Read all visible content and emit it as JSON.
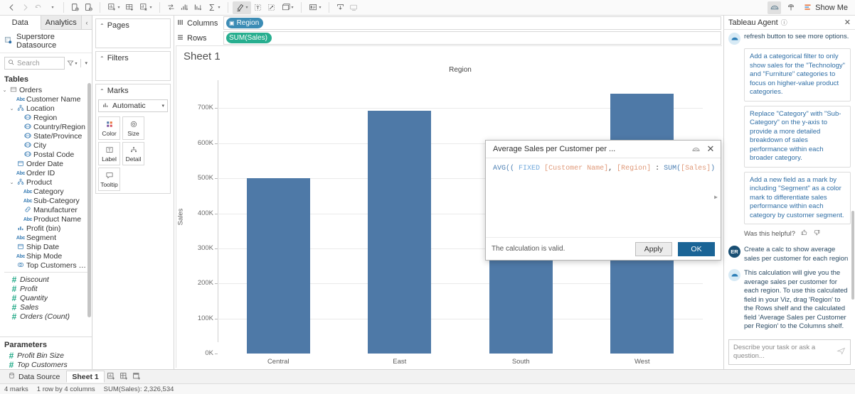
{
  "toolbar": {
    "back_icon": "back-arrow-icon",
    "forward_icon": "forward-arrow-icon",
    "undo_icon": "undo-icon",
    "save_icon": "save-icon",
    "pause_icon": "pause-auto-update-icon",
    "new_sheet_icon": "new-worksheet-icon",
    "new_dashboard_icon": "new-dashboard-icon",
    "clear_icon": "clear-sheet-icon",
    "swap_icon": "swap-rows-columns-icon",
    "sort_asc_icon": "sort-ascending-icon",
    "sort_desc_icon": "sort-descending-icon",
    "totals_icon": "totals-icon",
    "highlight_icon": "highlighter-icon",
    "labels_icon": "show-mark-labels-icon",
    "fit_icon": "fix-axes-icon",
    "fitsize_icon": "fit-selector-icon",
    "presentation_icon": "presentation-mode-icon",
    "card_icon": "show-hide-cards-icon",
    "download_icon": "download-icon",
    "device_icon": "device-preview-icon",
    "ai_icon": "einstein-copilot-icon",
    "showme_icon": "show-me-icon",
    "showme_label": "Show Me"
  },
  "data_pane": {
    "tab_data": "Data",
    "tab_analytics": "Analytics",
    "collapse_icon": "collapse-pane-icon",
    "datasource_name": "Superstore Datasource",
    "datasource_icon": "datasource-icon",
    "search_placeholder": "Search",
    "search_icon": "search-icon",
    "filter_icon": "filter-sort-icon",
    "menu_icon": "chevron-down-icon",
    "tables_header": "Tables",
    "fields": [
      {
        "label": "Orders",
        "icon": "table-icon",
        "indent": 0,
        "twisty": "open"
      },
      {
        "label": "Customer Name",
        "icon": "abc",
        "indent": 1,
        "twisty": ""
      },
      {
        "label": "Location",
        "icon": "hierarchy",
        "indent": 1,
        "twisty": "open"
      },
      {
        "label": "Region",
        "icon": "geo",
        "indent": 2,
        "twisty": ""
      },
      {
        "label": "Country/Region",
        "icon": "geo",
        "indent": 2,
        "twisty": ""
      },
      {
        "label": "State/Province",
        "icon": "geo",
        "indent": 2,
        "twisty": ""
      },
      {
        "label": "City",
        "icon": "geo",
        "indent": 2,
        "twisty": ""
      },
      {
        "label": "Postal Code",
        "icon": "geo",
        "indent": 2,
        "twisty": ""
      },
      {
        "label": "Order Date",
        "icon": "date",
        "indent": 1,
        "twisty": ""
      },
      {
        "label": "Order ID",
        "icon": "abc",
        "indent": 1,
        "twisty": ""
      },
      {
        "label": "Product",
        "icon": "hierarchy",
        "indent": 1,
        "twisty": "open"
      },
      {
        "label": "Category",
        "icon": "abc",
        "indent": 2,
        "twisty": ""
      },
      {
        "label": "Sub-Category",
        "icon": "abc",
        "indent": 2,
        "twisty": ""
      },
      {
        "label": "Manufacturer",
        "icon": "link",
        "indent": 2,
        "twisty": ""
      },
      {
        "label": "Product Name",
        "icon": "abc",
        "indent": 2,
        "twisty": ""
      },
      {
        "label": "Profit (bin)",
        "icon": "bin",
        "indent": 1,
        "twisty": ""
      },
      {
        "label": "Segment",
        "icon": "abc",
        "indent": 1,
        "twisty": ""
      },
      {
        "label": "Ship Date",
        "icon": "date",
        "indent": 1,
        "twisty": ""
      },
      {
        "label": "Ship Mode",
        "icon": "abc",
        "indent": 1,
        "twisty": ""
      },
      {
        "label": "Top Customers by P...",
        "icon": "set",
        "indent": 1,
        "twisty": ""
      }
    ],
    "measures": [
      {
        "label": "Discount",
        "icon": "num"
      },
      {
        "label": "Profit",
        "icon": "num"
      },
      {
        "label": "Quantity",
        "icon": "num"
      },
      {
        "label": "Sales",
        "icon": "num"
      },
      {
        "label": "Orders (Count)",
        "icon": "num"
      }
    ],
    "parameters_header": "Parameters",
    "parameters": [
      {
        "label": "Profit Bin Size",
        "icon": "num"
      },
      {
        "label": "Top Customers",
        "icon": "num"
      }
    ]
  },
  "shelves": {
    "pages_label": "Pages",
    "filters_label": "Filters",
    "marks_label": "Marks",
    "marks_type": "Automatic",
    "marks_type_icon": "bar-mark-icon",
    "marks_buttons": [
      {
        "label": "Color",
        "icon": "color-icon"
      },
      {
        "label": "Size",
        "icon": "size-icon"
      },
      {
        "label": "Label",
        "icon": "label-icon"
      },
      {
        "label": "Detail",
        "icon": "detail-icon"
      },
      {
        "label": "Tooltip",
        "icon": "tooltip-icon"
      }
    ],
    "columns_label": "Columns",
    "columns_icon": "columns-icon",
    "rows_label": "Rows",
    "rows_icon": "rows-icon",
    "columns_pill": "Region",
    "columns_pill_icon": "dimension-icon",
    "rows_pill": "SUM(Sales)",
    "dimension_color": "#3c8cb5",
    "measure_color": "#27ae8f"
  },
  "viz": {
    "sheet_title": "Sheet 1",
    "bar_color": "#4e79a7"
  },
  "chart_data": {
    "type": "bar",
    "title": "Sheet 1",
    "column_header": "Region",
    "xlabel": "Region",
    "ylabel": "Sales",
    "categories": [
      "Central",
      "East",
      "South",
      "West"
    ],
    "values": [
      501240,
      692000,
      392000,
      741240
    ],
    "ytick_labels": [
      "0K",
      "100K",
      "200K",
      "300K",
      "400K",
      "500K",
      "600K",
      "700K"
    ],
    "ytick_values": [
      0,
      100000,
      200000,
      300000,
      400000,
      500000,
      600000,
      700000
    ],
    "ylim": [
      0,
      780000
    ],
    "grid": true,
    "legend": "none",
    "series": [
      {
        "name": "SUM(Sales)",
        "values": [
          501240,
          692000,
          392000,
          741240
        ]
      }
    ]
  },
  "calc_dialog": {
    "title": "Average Sales per Customer per ...",
    "ai_icon": "einstein-icon",
    "close_icon": "close-icon",
    "formula_tokens": [
      {
        "text": "AVG((",
        "type": "fn"
      },
      {
        "text": " ",
        "type": "plain"
      },
      {
        "text": "FIXED",
        "type": "kw"
      },
      {
        "text": " ",
        "type": "plain"
      },
      {
        "text": "[Customer Name]",
        "type": "fld"
      },
      {
        "text": ", ",
        "type": "plain"
      },
      {
        "text": "[Region]",
        "type": "fld"
      },
      {
        "text": " : ",
        "type": "plain"
      },
      {
        "text": "SUM(",
        "type": "fn"
      },
      {
        "text": "[Sales]",
        "type": "fld"
      },
      {
        "text": ") ))",
        "type": "fn"
      }
    ],
    "formula_plain": "AVG(( FIXED [Customer Name], [Region] : SUM([Sales]) ))",
    "status": "The calculation is valid.",
    "apply_label": "Apply",
    "ok_label": "OK",
    "expand_icon": "expand-arrow-icon"
  },
  "agent": {
    "title": "Tableau Agent",
    "info_icon": "info-icon",
    "close_icon": "close-icon",
    "intro_partial": "refresh button to see more options.",
    "suggestions_1": [
      "Add a categorical filter to only show sales for the \"Technology\" and \"Furniture\" categories to focus on higher-value product categories.",
      "Replace \"Category\" with \"Sub-Category\" on the y-axis to provide a more detailed breakdown of sales performance within each broader category.",
      "Add a new field as a mark by including \"Segment\" as a color mark to differentiate sales performance within each category by customer segment."
    ],
    "helpful_label": "Was this helpful?",
    "thumbs_up_icon": "thumbs-up-icon",
    "thumbs_down_icon": "thumbs-down-icon",
    "user_initials": "ER",
    "user_message": "Create a calc to show average sales per customer for each region",
    "bot_message": "This calculation will give you the average sales per customer for each region. To use this calculated field in your Viz, drag 'Region' to the Rows shelf and the calculated field 'Average Sales per Customer per Region' to the Columns shelf.",
    "input_placeholder": "Describe your task or ask a question...",
    "send_icon": "send-icon"
  },
  "bottom": {
    "data_source_label": "Data Source",
    "data_source_icon": "data-source-icon",
    "sheet_tab": "Sheet 1",
    "new_sheet_icon": "new-worksheet-tab-icon",
    "new_dashboard_icon": "new-dashboard-tab-icon",
    "new_story_icon": "new-story-tab-icon",
    "status_marks": "4 marks",
    "status_rowcol": "1 row by 4 columns",
    "status_sum": "SUM(Sales): 2,326,534"
  }
}
